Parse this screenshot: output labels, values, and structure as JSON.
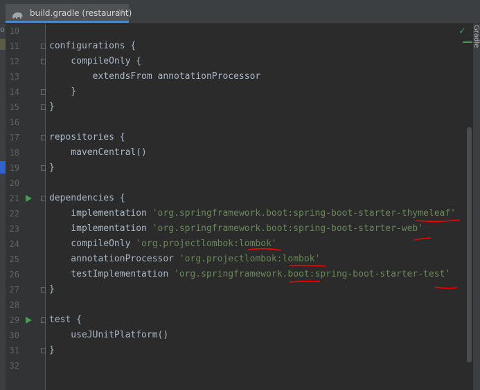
{
  "tab": {
    "title": "build.gradle (restaurant)",
    "close_glyph": "×",
    "icon": "gradle-elephant-icon"
  },
  "left_panel": {
    "fragment": "o"
  },
  "right_panel": {
    "label": "Gradle",
    "status_icon": "checkmark-icon"
  },
  "colors": {
    "background": "#2b2b2b",
    "keyword": "#a9b7c6",
    "string": "#6a8759",
    "run": "#499c54",
    "annotation": "#ff0000"
  },
  "editor": {
    "lines": [
      {
        "number": "10",
        "parts": []
      },
      {
        "number": "11",
        "parts": [
          {
            "text": "configurations {",
            "kind": "plain"
          }
        ]
      },
      {
        "number": "12",
        "parts": [
          {
            "text": "    compileOnly {",
            "kind": "plain"
          }
        ]
      },
      {
        "number": "13",
        "parts": [
          {
            "text": "        extendsFrom annotationProcessor",
            "kind": "plain"
          }
        ]
      },
      {
        "number": "14",
        "parts": [
          {
            "text": "    }",
            "kind": "plain"
          }
        ]
      },
      {
        "number": "15",
        "parts": [
          {
            "text": "}",
            "kind": "plain"
          }
        ]
      },
      {
        "number": "16",
        "parts": []
      },
      {
        "number": "17",
        "parts": [
          {
            "text": "repositories {",
            "kind": "plain"
          }
        ]
      },
      {
        "number": "18",
        "parts": [
          {
            "text": "    mavenCentral()",
            "kind": "plain"
          }
        ]
      },
      {
        "number": "19",
        "parts": [
          {
            "text": "}",
            "kind": "plain"
          }
        ]
      },
      {
        "number": "20",
        "parts": []
      },
      {
        "number": "21",
        "parts": [
          {
            "text": "dependencies {",
            "kind": "plain"
          }
        ]
      },
      {
        "number": "22",
        "parts": [
          {
            "text": "    implementation ",
            "kind": "plain"
          },
          {
            "text": "'org.springframework.boot:spring-boot-starter-thymeleaf'",
            "kind": "string"
          }
        ]
      },
      {
        "number": "23",
        "parts": [
          {
            "text": "    implementation ",
            "kind": "plain"
          },
          {
            "text": "'org.springframework.boot:spring-boot-starter-web'",
            "kind": "string"
          }
        ]
      },
      {
        "number": "24",
        "parts": [
          {
            "text": "    compileOnly ",
            "kind": "plain"
          },
          {
            "text": "'org.projectlombok:lombok'",
            "kind": "string"
          }
        ]
      },
      {
        "number": "25",
        "parts": [
          {
            "text": "    annotationProcessor ",
            "kind": "plain"
          },
          {
            "text": "'org.projectlombok:lombok'",
            "kind": "string"
          }
        ]
      },
      {
        "number": "26",
        "parts": [
          {
            "text": "    testImplementation ",
            "kind": "plain"
          },
          {
            "text": "'org.springframework.boot:spring-boot-starter-test'",
            "kind": "string"
          }
        ]
      },
      {
        "number": "27",
        "parts": [
          {
            "text": "}",
            "kind": "plain"
          }
        ]
      },
      {
        "number": "28",
        "parts": []
      },
      {
        "number": "29",
        "parts": [
          {
            "text": "test {",
            "kind": "plain"
          }
        ]
      },
      {
        "number": "30",
        "parts": [
          {
            "text": "    useJUnitPlatform()",
            "kind": "plain"
          }
        ]
      },
      {
        "number": "31",
        "parts": [
          {
            "text": "}",
            "kind": "plain"
          }
        ]
      },
      {
        "number": "32",
        "parts": []
      }
    ],
    "run_markers": [
      "21",
      "29"
    ]
  }
}
